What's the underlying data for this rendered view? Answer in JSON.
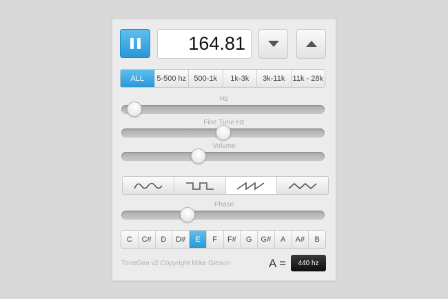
{
  "app": {
    "copyright": "ToneGen v2 Copyright Mike Gieson"
  },
  "controls": {
    "play_state_icon": "pause-icon",
    "frequency": "164.81",
    "step_down_icon": "triangle-down-icon",
    "step_up_icon": "triangle-up-icon"
  },
  "ranges": {
    "items": [
      "ALL",
      "5-500 hz",
      "500-1k",
      "1k-3k",
      "3k-11k",
      "11k - 28k"
    ],
    "selected": "ALL"
  },
  "sliders": {
    "hz": {
      "label": "Hz",
      "value": 0.03
    },
    "fine_tune": {
      "label": "Fine Tune Hz",
      "value": 0.5
    },
    "volume": {
      "label": "Volume",
      "value": 0.37
    },
    "phase": {
      "label": "Phase",
      "value": 0.31
    }
  },
  "waveforms": {
    "items": [
      "sine-wave-icon",
      "square-wave-icon",
      "sawtooth-wave-icon",
      "triangle-wave-icon"
    ],
    "selected": "sawtooth-wave-icon"
  },
  "notes": {
    "items": [
      "C",
      "C#",
      "D",
      "D#",
      "E",
      "F",
      "F#",
      "G",
      "G#",
      "A",
      "A#",
      "B"
    ],
    "selected": "E"
  },
  "reference": {
    "label": "A =",
    "value": "440 hz"
  },
  "colors": {
    "accent": "#2a97d9",
    "accent_light": "#5cc0ee",
    "panel": "#ececec",
    "background": "#d9d9d9"
  }
}
